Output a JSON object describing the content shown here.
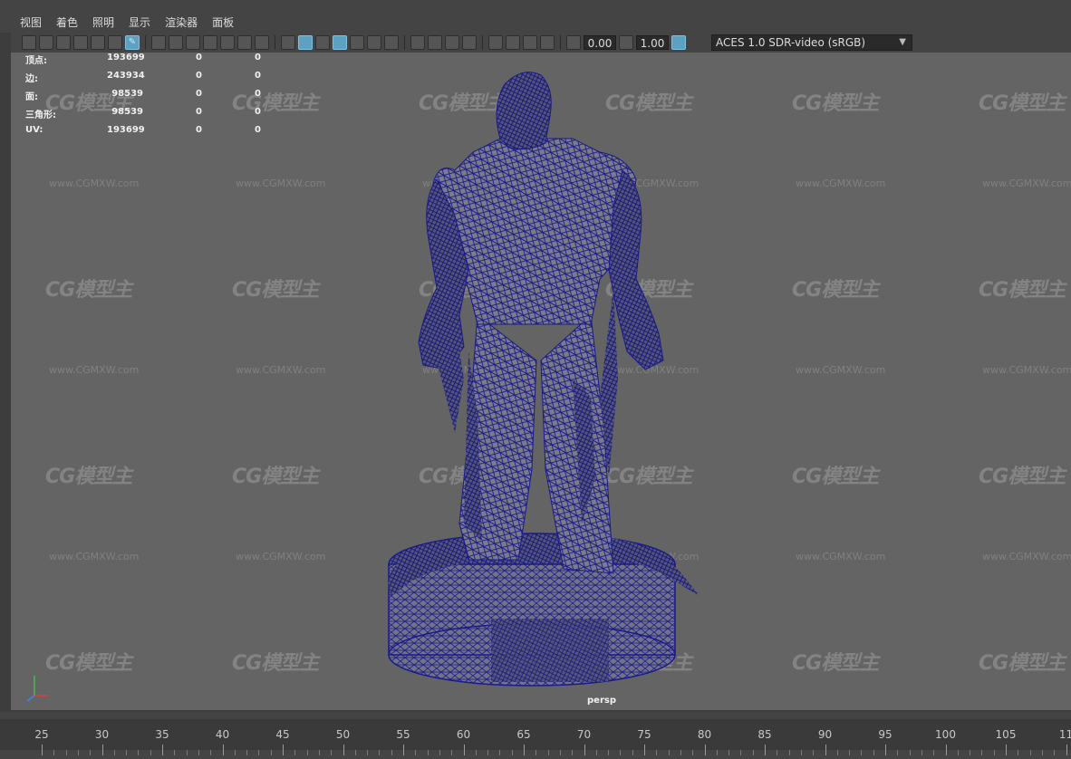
{
  "menu": [
    "视图",
    "着色",
    "照明",
    "显示",
    "渲染器",
    "面板"
  ],
  "toolbar": {
    "exposure_value": "0.00",
    "gamma_value": "1.00",
    "color_management": "ACES 1.0 SDR-video (sRGB)"
  },
  "hud_stats": [
    {
      "label": "顶点:",
      "v1": "193699",
      "v2": "0",
      "v3": "0"
    },
    {
      "label": "边:",
      "v1": "243934",
      "v2": "0",
      "v3": "0"
    },
    {
      "label": "面:",
      "v1": "98539",
      "v2": "0",
      "v3": "0"
    },
    {
      "label": "三角形:",
      "v1": "98539",
      "v2": "0",
      "v3": "0"
    },
    {
      "label": "UV:",
      "v1": "193699",
      "v2": "0",
      "v3": "0"
    }
  ],
  "viewport": {
    "camera": "persp",
    "background_color": "#646464",
    "wireframe_color": "#1a1a8a"
  },
  "watermark": {
    "logo": "CG模型主",
    "url": "www.CGMXW.com"
  },
  "timeline": {
    "ticks": [
      "25",
      "30",
      "35",
      "40",
      "45",
      "50",
      "55",
      "60",
      "65",
      "70",
      "75",
      "80",
      "85",
      "90",
      "95",
      "100",
      "105",
      "11"
    ]
  },
  "colors": {
    "ui_bg": "#444444",
    "active_icon": "#5ea0c2",
    "axis_x": "#d84040",
    "axis_y": "#40c040",
    "axis_z": "#4080ff"
  }
}
